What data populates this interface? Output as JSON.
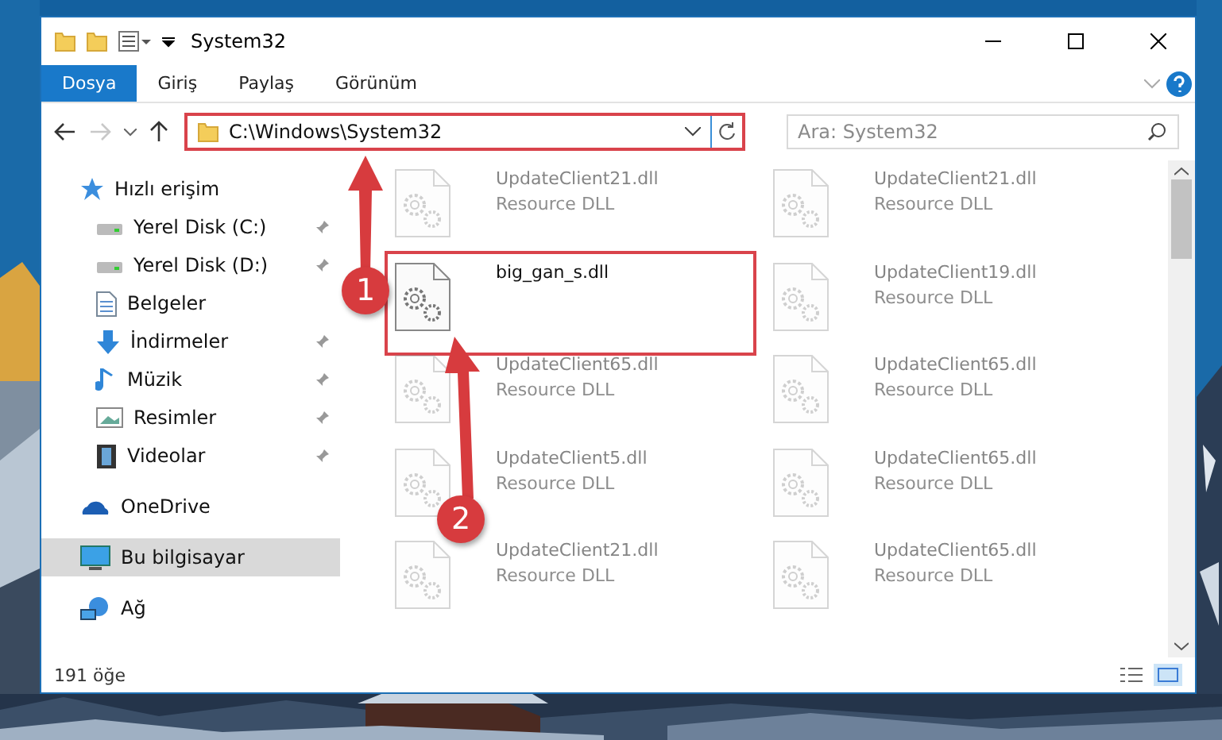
{
  "window": {
    "title": "System32"
  },
  "ribbon": {
    "tabs": [
      {
        "label": "Dosya",
        "selected": true
      },
      {
        "label": "Giriş",
        "selected": false
      },
      {
        "label": "Paylaş",
        "selected": false
      },
      {
        "label": "Görünüm",
        "selected": false
      }
    ]
  },
  "address": {
    "path": "C:\\Windows\\System32",
    "search_placeholder": "Ara: System32",
    "forward_disabled": true
  },
  "sidebar": {
    "items": [
      {
        "label": "Hızlı erişim",
        "kind": "star",
        "pinned": false,
        "selected": false,
        "children": [
          {
            "label": "Yerel Disk (C:)",
            "kind": "drive",
            "pinned": true,
            "selected": false
          },
          {
            "label": "Yerel Disk (D:)",
            "kind": "drive",
            "pinned": true,
            "selected": false
          },
          {
            "label": "Belgeler",
            "kind": "document",
            "pinned": false,
            "selected": false
          },
          {
            "label": "İndirmeler",
            "kind": "download",
            "pinned": true,
            "selected": false
          },
          {
            "label": "Müzik",
            "kind": "music",
            "pinned": true,
            "selected": false
          },
          {
            "label": "Resimler",
            "kind": "pictures",
            "pinned": true,
            "selected": false
          },
          {
            "label": "Videolar",
            "kind": "video",
            "pinned": true,
            "selected": false
          }
        ]
      },
      {
        "label": "OneDrive",
        "kind": "cloud",
        "pinned": false,
        "selected": false
      },
      {
        "label": "Bu bilgisayar",
        "kind": "computer",
        "pinned": false,
        "selected": true
      },
      {
        "label": "Ağ",
        "kind": "network",
        "pinned": false,
        "selected": false
      }
    ]
  },
  "files": [
    {
      "name": "UpdateClient21.dll",
      "type": "Resource DLL",
      "faded": true
    },
    {
      "name": "UpdateClient21.dll",
      "type": "Resource DLL",
      "faded": true
    },
    {
      "name": "big_gan_s.dll",
      "faded": false,
      "highlighted": true
    },
    {
      "name": "UpdateClient19.dll",
      "type": "Resource DLL",
      "faded": true
    },
    {
      "name": "UpdateClient65.dll",
      "type": "Resource DLL",
      "faded": true
    },
    {
      "name": "UpdateClient65.dll",
      "type": "Resource DLL",
      "faded": true
    },
    {
      "name": "UpdateClient5.dll",
      "type": "Resource DLL",
      "faded": true
    },
    {
      "name": "UpdateClient65.dll",
      "type": "Resource DLL",
      "faded": true
    },
    {
      "name": "UpdateClient21.dll",
      "type": "Resource DLL",
      "faded": true
    },
    {
      "name": "UpdateClient65.dll",
      "type": "Resource DLL",
      "faded": true
    }
  ],
  "status_bar": {
    "count": "191 öğe"
  },
  "callouts": [
    {
      "number": "1"
    },
    {
      "number": "2"
    }
  ]
}
